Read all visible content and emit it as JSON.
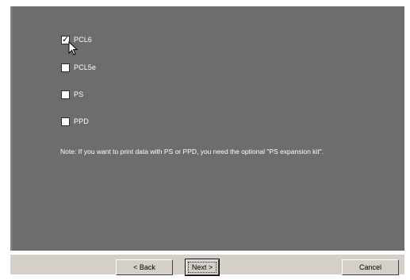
{
  "options": [
    {
      "label": "PCL6",
      "checked": true
    },
    {
      "label": "PCL5e",
      "checked": false
    },
    {
      "label": "PS",
      "checked": false
    },
    {
      "label": "PPD",
      "checked": false
    }
  ],
  "note": "Note: If you want to print data with PS or PPD, you need the optional \"PS expansion kit\".",
  "buttons": {
    "back": "< Back",
    "next": "Next >",
    "cancel": "Cancel"
  },
  "colors": {
    "panel": "#6d6d6d",
    "button_face": "#d4d0c8"
  }
}
